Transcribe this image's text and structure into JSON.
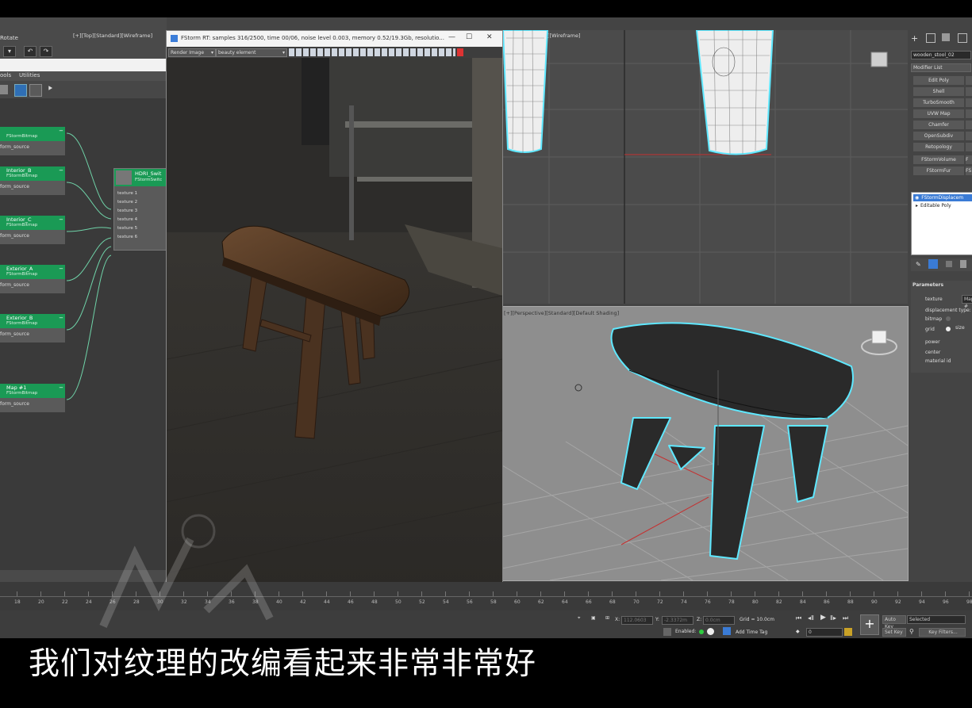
{
  "slate": {
    "toolbar_title": "Rotate",
    "menu": [
      "ools",
      "Utilities"
    ],
    "nodes": [
      {
        "name": "",
        "type": "FStormBitmap",
        "port": "form_source"
      },
      {
        "name": "Interior_B",
        "type": "FStormBitmap",
        "port": "form_source"
      },
      {
        "name": "Interior_C",
        "type": "FStormBitmap",
        "port": "form_source"
      },
      {
        "name": "Exterior_A",
        "type": "FStormBitmap",
        "port": "form_source"
      },
      {
        "name": "Exterior_B",
        "type": "FStormBitmap",
        "port": "form_source"
      },
      {
        "name": "Map #1",
        "type": "FStormBitmap",
        "port": "form_source"
      }
    ],
    "switch_node": {
      "name": "HDRI_Swit",
      "type": "FStormSwitc",
      "inputs": [
        "texture 1",
        "texture 2",
        "texture 3",
        "texture 4",
        "texture 5",
        "texture 6"
      ]
    }
  },
  "render_window": {
    "title": "FStorm RT: samples 316/2500, time 00/06, noise level 0.003, memory 0.52/19.3Gb, resolutio...",
    "element_select": "Render Image",
    "beauty_select": "beauty element",
    "minimize": "—",
    "maximize": "☐",
    "close": "✕"
  },
  "viewport_top_label": "[+][Top][Standard][Wireframe]",
  "viewport_top_right_label": "][Wireframe]",
  "viewport_persp_label": "[+][Perspective][Standard][Default Shading]",
  "command_panel": {
    "object_name": "wooden_stool_02",
    "modifier_list": "Modifier List",
    "modifiers": [
      "Edit Poly",
      "Shell",
      "TurboSmooth",
      "UVW Map",
      "Chamfer",
      "OpenSubdiv",
      "Retopology",
      "FStormVolume",
      "FStormFur"
    ],
    "modifiers_right": [
      "",
      "",
      "",
      "",
      "",
      "",
      "",
      "F",
      "FS"
    ],
    "stack": [
      "FStormDisplacem",
      "Editable Poly"
    ],
    "rollout": "Parameters",
    "params": [
      "texture",
      "displacement type:",
      "bitmap",
      "grid",
      "power",
      "center",
      "material id"
    ],
    "texture_value": "Map #",
    "size_label": "size"
  },
  "timeline_ticks": [
    "18",
    "20",
    "22",
    "24",
    "26",
    "28",
    "30",
    "32",
    "34",
    "36",
    "38",
    "40",
    "42",
    "44",
    "46",
    "48",
    "50",
    "52",
    "54",
    "56",
    "58",
    "60",
    "62",
    "64",
    "66",
    "68",
    "70",
    "72",
    "74",
    "76",
    "78",
    "80",
    "82",
    "84",
    "86",
    "88",
    "90",
    "92",
    "94",
    "96",
    "98"
  ],
  "status_bar": {
    "x_label": "X:",
    "x_value": "112.0603",
    "y_label": "Y:",
    "y_value": "-2.3372m",
    "z_label": "Z:",
    "z_value": "0.0cm",
    "grid": "Grid = 10.0cm",
    "enabled": "Enabled:",
    "add_time_tag": "Add Time Tag",
    "auto_key": "Auto Key",
    "selected": "Selected",
    "set_key": "Set Key",
    "key_filters": "Key Filters...",
    "frame": "0"
  },
  "subtitle": "我们对纹理的改编看起来非常非常好",
  "colors": {
    "node_green": "#1a9a55",
    "selection_cyan": "#5fe8ff",
    "stack_highlight": "#3a7bd5"
  }
}
